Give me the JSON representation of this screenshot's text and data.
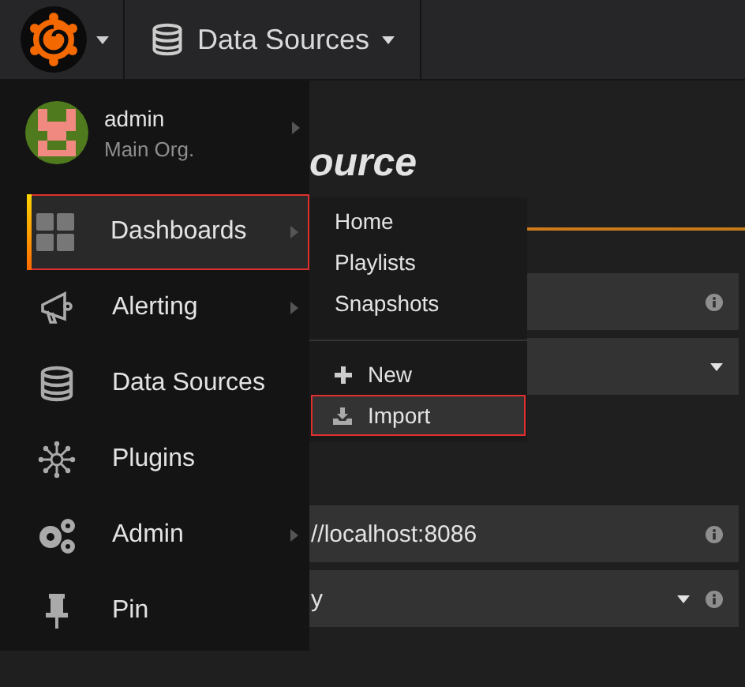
{
  "navbar": {
    "section": "Data Sources"
  },
  "page": {
    "title": "ource",
    "fields": [
      {
        "kind": "text",
        "info": true
      },
      {
        "kind": "select",
        "info": false
      }
    ],
    "http_fields": [
      {
        "value": "//localhost:8086",
        "kind": "text",
        "info": true
      },
      {
        "value": "y",
        "kind": "select",
        "info": true
      }
    ]
  },
  "side_menu": {
    "user": {
      "name": "admin",
      "org": "Main Org."
    },
    "items": [
      {
        "label": "Dashboards",
        "selected": true,
        "outlined": true,
        "submenu": true
      },
      {
        "label": "Alerting",
        "selected": false,
        "outlined": false,
        "submenu": true
      },
      {
        "label": "Data Sources",
        "selected": false,
        "outlined": false,
        "submenu": false
      },
      {
        "label": "Plugins",
        "selected": false,
        "outlined": false,
        "submenu": false
      },
      {
        "label": "Admin",
        "selected": false,
        "outlined": false,
        "submenu": true
      },
      {
        "label": "Pin",
        "selected": false,
        "outlined": false,
        "submenu": false
      }
    ]
  },
  "submenu": {
    "items": [
      {
        "label": "Home",
        "kind": "link",
        "outlined": false
      },
      {
        "label": "Playlists",
        "kind": "link",
        "outlined": false
      },
      {
        "label": "Snapshots",
        "kind": "link",
        "outlined": false
      },
      {
        "kind": "divider"
      },
      {
        "label": "New",
        "kind": "new",
        "outlined": false
      },
      {
        "label": "Import",
        "kind": "import",
        "outlined": true
      }
    ]
  }
}
